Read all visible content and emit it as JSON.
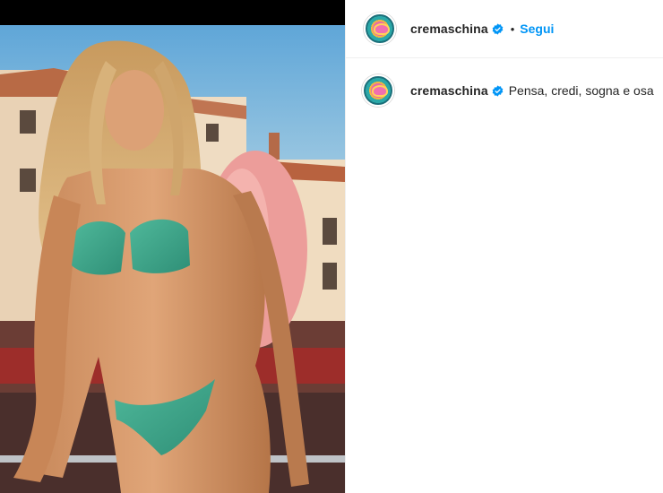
{
  "post": {
    "username": "cremaschina",
    "verified": true,
    "follow_label": "Segui",
    "separator": "•",
    "caption": "Pensa, credi, sogna e osa"
  },
  "colors": {
    "follow": "#0095f6",
    "verified_badge": "#0095f6",
    "text": "#262626"
  },
  "icons": {
    "verified": "verified-badge-icon"
  }
}
